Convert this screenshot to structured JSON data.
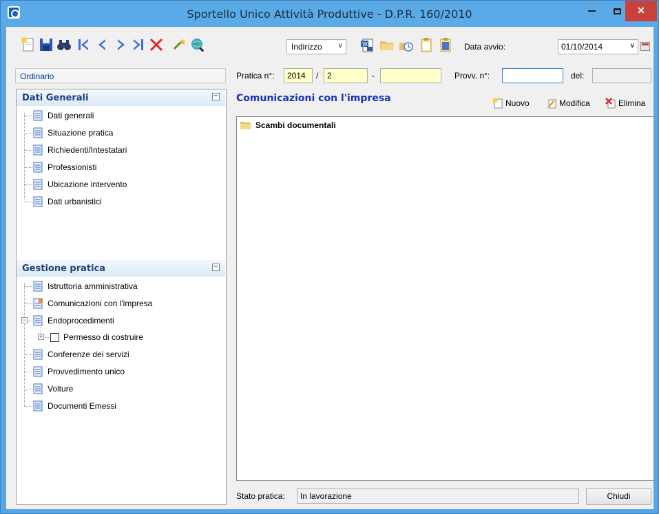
{
  "window": {
    "title": "Sportello Unico Attività Produttive - D.P.R. 160/2010",
    "minimize_glyph": "",
    "maximize_glyph": "",
    "close_glyph": "✕"
  },
  "toolbar": {
    "icons": [
      "new-document-icon",
      "save-icon",
      "binoculars-icon",
      "first-record-icon",
      "previous-record-icon",
      "next-record-icon",
      "last-record-icon",
      "delete-icon",
      "wand-icon",
      "search-globe-icon",
      "word-document-icon",
      "open-folder-icon",
      "history-icon",
      "clipboard-icon",
      "clipboard-check-icon"
    ],
    "search_field": "Indirizzo",
    "data_avvio_label": "Data avvio:",
    "data_avvio_value": "01/10/2014"
  },
  "header": {
    "pratica_label": "Pratica n°:",
    "pratica_year": "2014",
    "pratica_sep": "/",
    "pratica_number": "2",
    "dash": "-",
    "pratica_suffix": "",
    "provv_label": "Provv. n°:",
    "provv_value": "",
    "del_label": "del:",
    "del_value": ""
  },
  "left": {
    "procedure_type": "Ordinario",
    "groups": [
      {
        "title": "Dati Generali",
        "items": [
          "Dati generali",
          "Situazione pratica",
          "Richiedenti/Intestatari",
          "Professionisti",
          "Ubicazione intervento",
          "Dati urbanistici"
        ]
      },
      {
        "title": "Gestione pratica",
        "items": [
          "Istruttoria amministrativa",
          "Comunicazioni con l'impresa",
          "Endoprocedimenti",
          "Permesso di costruire",
          "Conferenze dei servizi",
          "Provvedimento unico",
          "Volture",
          "Documenti Emessi"
        ]
      }
    ]
  },
  "main": {
    "section_title": "Comunicazioni con l'impresa",
    "actions": {
      "new": "Nuovo",
      "edit": "Modifica",
      "delete": "Elimina"
    },
    "folder": "Scambi documentali"
  },
  "footer": {
    "status_label": "Stato pratica:",
    "status_value": "In lavorazione",
    "close_label": "Chiudi"
  },
  "colors": {
    "title_bar": "#5aaae8",
    "close_button": "#c9413c",
    "accent_text": "#1a2ec2",
    "group_header_text": "#1a3f82",
    "yellow_field": "#ffffc8"
  }
}
